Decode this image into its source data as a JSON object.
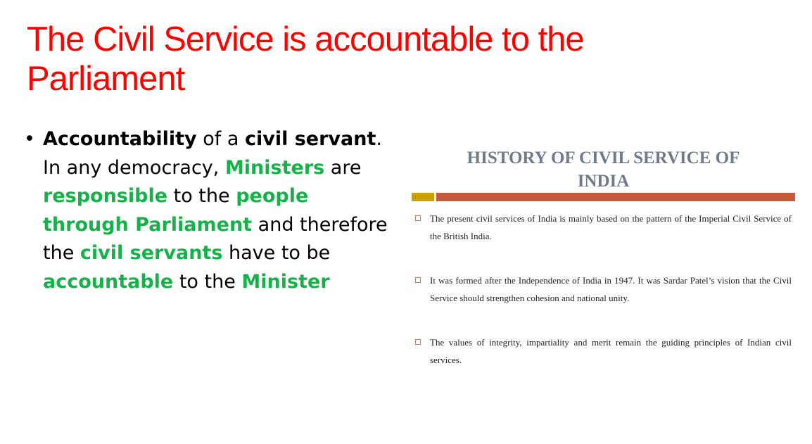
{
  "slide": {
    "title": "The Civil Service is accountable to the Parliament"
  },
  "bullet": {
    "marker": "•",
    "segments": [
      {
        "text": "Accountability",
        "style": "bold"
      },
      {
        "text": " of a ",
        "style": "plain"
      },
      {
        "text": "civil servant",
        "style": "bold"
      },
      {
        "text": ". In any democracy, ",
        "style": "plain"
      },
      {
        "text": "Ministers",
        "style": "green"
      },
      {
        "text": " are ",
        "style": "plain"
      },
      {
        "text": "responsible",
        "style": "green"
      },
      {
        "text": " to the ",
        "style": "plain"
      },
      {
        "text": "people through Parliament",
        "style": "green"
      },
      {
        "text": " and therefore the ",
        "style": "plain"
      },
      {
        "text": "civil servants",
        "style": "green"
      },
      {
        "text": " have to be ",
        "style": "plain"
      },
      {
        "text": "accountable",
        "style": "green"
      },
      {
        "text": " to the ",
        "style": "plain"
      },
      {
        "text": "Minister",
        "style": "green"
      }
    ]
  },
  "inset": {
    "heading_line1": "HISTORY OF CIVIL SERVICE OF",
    "heading_line2": "INDIA",
    "items": [
      "The present civil services of India is mainly based on the pattern of the Imperial Civil Service of the British India.",
      "It was formed after the Independence of India in 1947. It was Sardar Patel’s vision that the Civil Service should strengthen cohesion and national unity.",
      "The values of integrity, impartiality and merit remain the guiding principles of Indian civil services."
    ]
  },
  "colors": {
    "title": "#ff0000",
    "highlight_green": "#17b14a",
    "inset_heading": "#707a8a",
    "accent_gold": "#c9a100",
    "accent_rust": "#c85a3c"
  }
}
